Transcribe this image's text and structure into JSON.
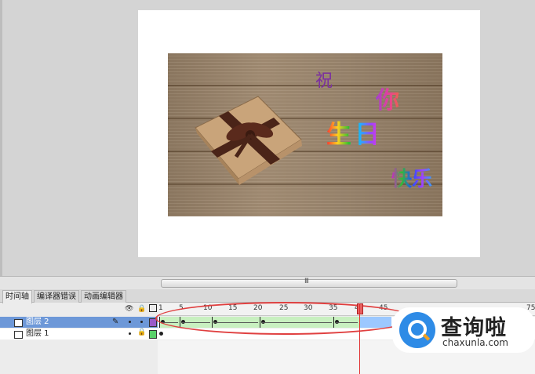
{
  "stage": {
    "texts": [
      "祝",
      "你",
      "生日",
      "快乐"
    ]
  },
  "scrollbar": {
    "grip": "III"
  },
  "timeline": {
    "tabs": [
      "时间轴",
      "编译器错误",
      "动画编辑器"
    ],
    "ruler": [
      "1",
      "5",
      "10",
      "15",
      "20",
      "25",
      "30",
      "35",
      "40",
      "45",
      "75"
    ],
    "layers": [
      {
        "name": "图层 2",
        "selected": true
      },
      {
        "name": "图层 1",
        "selected": false
      }
    ],
    "current_frame": 40
  },
  "brand": {
    "name": "查询啦",
    "domain": "chaxunla.com"
  },
  "colors": {
    "layer_selected": "#6d98d8",
    "tween_fill": "#c8f0c0",
    "playhead": "#e03030",
    "brand_blue": "#2e8be6"
  }
}
